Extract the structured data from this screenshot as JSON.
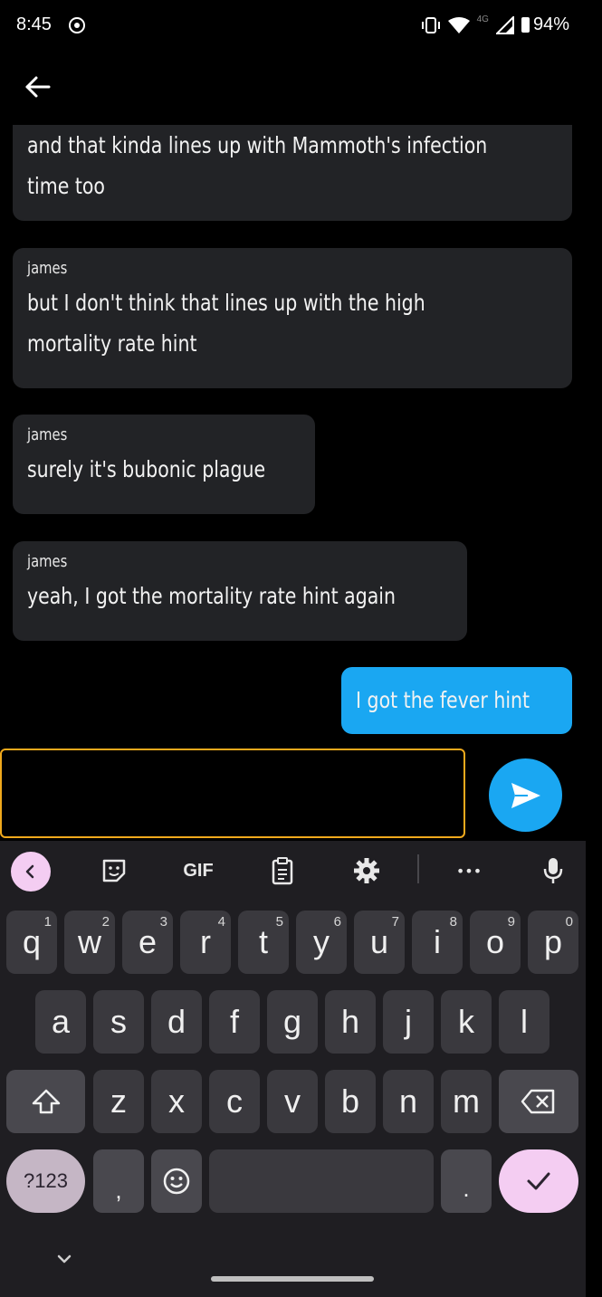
{
  "status": {
    "time": "8:45",
    "network": "4G",
    "battery": "94%"
  },
  "messages": [
    {
      "sender": "",
      "lines": [
        "and that kinda lines up with Mammoth's infection",
        "time too"
      ],
      "outgoing": false
    },
    {
      "sender": "james",
      "lines": [
        "but I don't think that lines up with the high",
        "mortality rate hint"
      ],
      "outgoing": false
    },
    {
      "sender": "james",
      "lines": [
        "surely it's bubonic plague"
      ],
      "outgoing": false
    },
    {
      "sender": "james",
      "lines": [
        "yeah, I got the mortality rate hint again"
      ],
      "outgoing": false
    },
    {
      "sender": "",
      "lines": [
        "I got the fever hint"
      ],
      "outgoing": true
    }
  ],
  "composer": {
    "value": ""
  },
  "keyboard": {
    "toolbar": {
      "gif_label": "GIF",
      "more_label": "•••"
    },
    "row1": [
      {
        "k": "q",
        "h": "1"
      },
      {
        "k": "w",
        "h": "2"
      },
      {
        "k": "e",
        "h": "3"
      },
      {
        "k": "r",
        "h": "4"
      },
      {
        "k": "t",
        "h": "5"
      },
      {
        "k": "y",
        "h": "6"
      },
      {
        "k": "u",
        "h": "7"
      },
      {
        "k": "i",
        "h": "8"
      },
      {
        "k": "o",
        "h": "9"
      },
      {
        "k": "p",
        "h": "0"
      }
    ],
    "row2": [
      "a",
      "s",
      "d",
      "f",
      "g",
      "h",
      "j",
      "k",
      "l"
    ],
    "row3": [
      "z",
      "x",
      "c",
      "v",
      "b",
      "n",
      "m"
    ],
    "symbols_label": "?123",
    "comma_label": ",",
    "period_label": ".",
    "collapse_label": "⌄"
  }
}
